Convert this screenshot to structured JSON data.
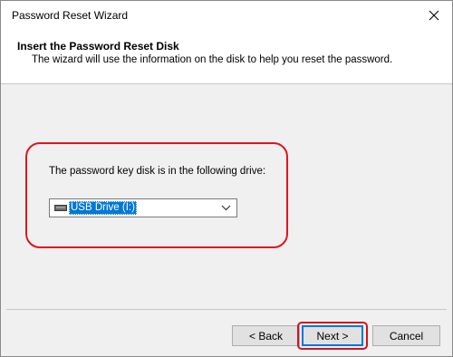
{
  "window": {
    "title": "Password Reset Wizard"
  },
  "header": {
    "title": "Insert the Password Reset Disk",
    "subtitle": "The wizard will use the information on the disk to help you reset the password."
  },
  "content": {
    "drive_label": "The password key disk is in the following drive:",
    "drive_select": {
      "selected": "USB Drive (I:)",
      "icon": "usb-drive-icon"
    }
  },
  "buttons": {
    "back": "< Back",
    "next": "Next >",
    "cancel": "Cancel"
  },
  "colors": {
    "selection": "#0078d7",
    "annotation": "#e0141e"
  }
}
